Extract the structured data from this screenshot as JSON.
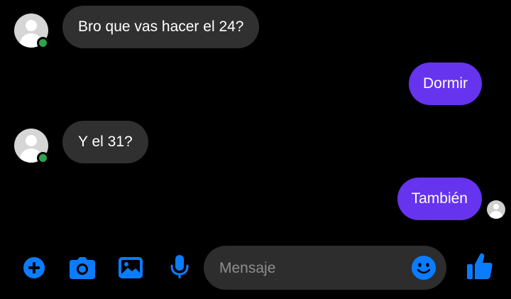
{
  "accent_color": "#0a7cff",
  "sent_bubble_color": "#6633ee",
  "received_bubble_color": "#303030",
  "messages": [
    {
      "direction": "received",
      "text": "Bro que vas hacer el 24?"
    },
    {
      "direction": "sent",
      "text": "Dormir"
    },
    {
      "direction": "received",
      "text": "Y el 31?"
    },
    {
      "direction": "sent",
      "text": "También"
    }
  ],
  "composer": {
    "placeholder": "Mensaje",
    "icons": [
      "plus-icon",
      "camera-icon",
      "image-icon",
      "microphone-icon",
      "emoji-icon",
      "thumbs-up-icon"
    ]
  }
}
